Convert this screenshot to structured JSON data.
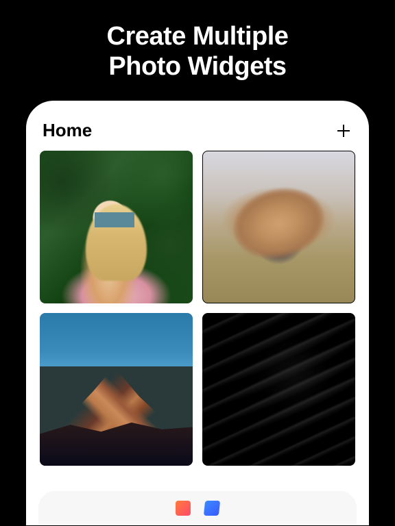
{
  "headline": {
    "line1": "Create Multiple",
    "line2": "Photo Widgets"
  },
  "app": {
    "title": "Home",
    "add_label": "Add"
  },
  "tiles": [
    {
      "name": "photo-widget-portrait-foliage"
    },
    {
      "name": "photo-widget-hair-field"
    },
    {
      "name": "photo-widget-mountain"
    },
    {
      "name": "photo-widget-sand-ripples"
    }
  ],
  "bottombar": {
    "icon1": "app-icon-orange",
    "icon2": "app-icon-blue"
  }
}
